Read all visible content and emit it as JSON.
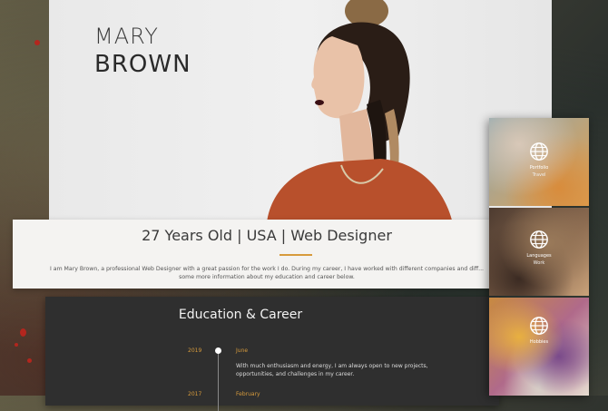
{
  "hero": {
    "first_name": "MARY",
    "last_name": "BROWN"
  },
  "info": {
    "tagline": "27 Years Old | USA | Web Designer",
    "bio": "I am Mary Brown, a professional Web Designer with a great passion for the work I do. During my career, I have worked with different companies and diff... some more information about my education and career below."
  },
  "education": {
    "title": "Education & Career",
    "entries": [
      {
        "year": "2019",
        "month": "June",
        "text": "With much enthusiasm and energy, I am always open to new projects, opportunities, and challenges in my career."
      },
      {
        "year": "2017",
        "month": "February",
        "text": ""
      }
    ]
  },
  "side_cards": [
    {
      "icon": "globe-icon",
      "line1": "Portfolio",
      "line2": "Travel"
    },
    {
      "icon": "globe-icon",
      "line1": "Languages",
      "line2": "Work"
    },
    {
      "icon": "globe-icon",
      "line1": "Hobbies",
      "line2": ""
    }
  ],
  "colors": {
    "accent": "#d79b3c",
    "dark_panel": "#2f2f2f",
    "light_band": "#f4f3f1"
  }
}
